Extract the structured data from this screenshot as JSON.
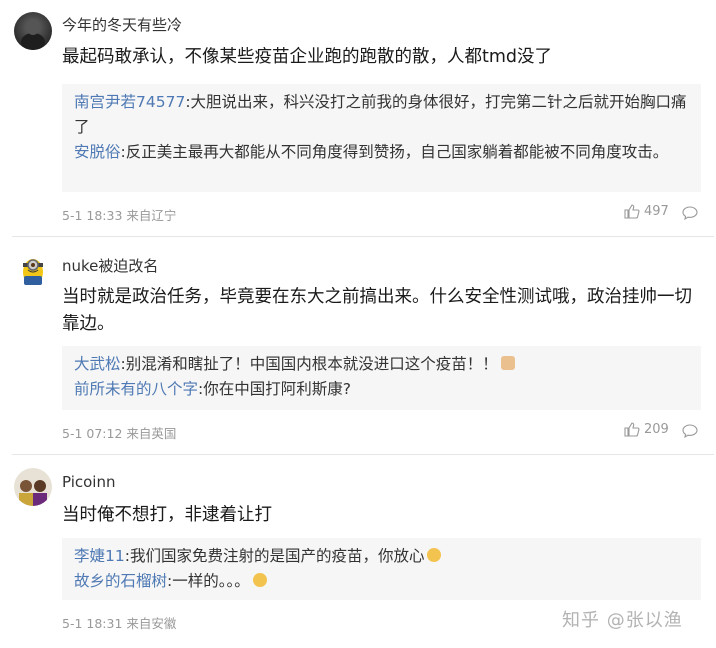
{
  "comments": [
    {
      "username": "今年的冬天有些冷",
      "content": "最起码敢承认，不像某些疫苗企业跑的跑散的散，人都tmd没了",
      "replies": [
        {
          "name": "南宫尹若74577",
          "sep": ":",
          "text": "大胆说出来，科兴没打之前我的身体很好，打完第二针之后就开始胸口痛了"
        },
        {
          "name": "安脱俗",
          "sep": ":",
          "text": "反正美主最再大都能从不同角度得到赞扬，自己国家躺着都能被不同角度攻击。"
        }
      ],
      "meta": "5-1 18:33 来自辽宁",
      "likes": "497"
    },
    {
      "username": "nuke被迫改名",
      "content": "当时就是政治任务，毕竟要在东大之前搞出来。什么安全性测试哦，政治挂帅一切靠边。",
      "replies": [
        {
          "name": "大武松",
          "sep": ":",
          "text": "别混淆和瞎扯了！中国国内根本就没进口这个疫苗！！",
          "emoji": "hand"
        },
        {
          "name": "前所未有的八个字",
          "sep": ":",
          "text": "你在中国打阿利斯康?"
        }
      ],
      "meta": "5-1 07:12 来自英国",
      "likes": "209"
    },
    {
      "username": "Picoinn",
      "content": "当时俺不想打，非逮着让打",
      "replies": [
        {
          "name": "李婕11",
          "sep": ":",
          "text": "我们国家免费注射的是国产的疫苗，你放心",
          "emoji": "laugh"
        },
        {
          "name": "故乡的石榴树",
          "sep": ":",
          "text": "一样的。。。",
          "emoji": "laugh"
        }
      ],
      "meta": "5-1 18:31 来自安徽",
      "likes": ""
    }
  ],
  "watermark": "知乎 @张以渔",
  "icons": {
    "like": "thumbs-up-icon",
    "reply": "speech-bubble-icon"
  },
  "colors": {
    "reply_name": "#4e79b4",
    "meta": "#999999",
    "reply_bg": "#f6f6f6"
  }
}
